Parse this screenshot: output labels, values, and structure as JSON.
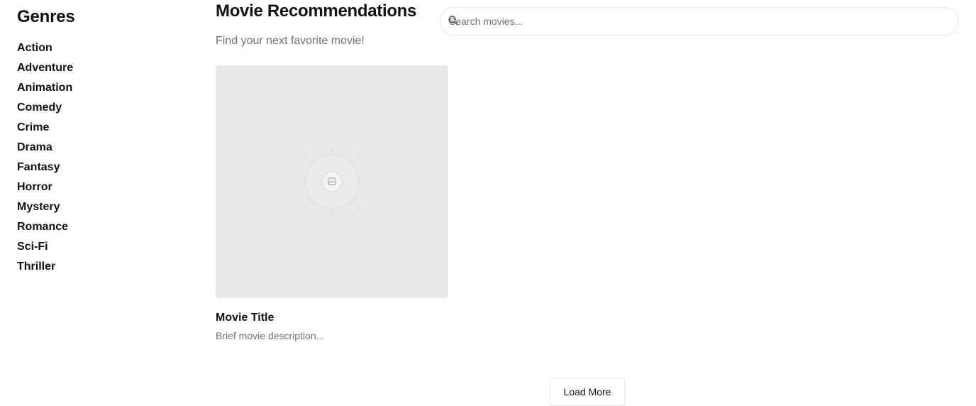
{
  "sidebar": {
    "title": "Genres",
    "genres": [
      "Action",
      "Adventure",
      "Animation",
      "Comedy",
      "Crime",
      "Drama",
      "Fantasy",
      "Horror",
      "Mystery",
      "Romance",
      "Sci-Fi",
      "Thriller"
    ]
  },
  "header": {
    "title": "Movie Recommendations",
    "subtitle": "Find your next favorite movie!"
  },
  "search": {
    "placeholder": "Search movies...",
    "value": "",
    "icon": "search-icon"
  },
  "movies": [
    {
      "title": "Movie Title",
      "description": "Brief movie description...",
      "poster_icon": "image-placeholder-icon"
    }
  ],
  "load_more_label": "Load More"
}
